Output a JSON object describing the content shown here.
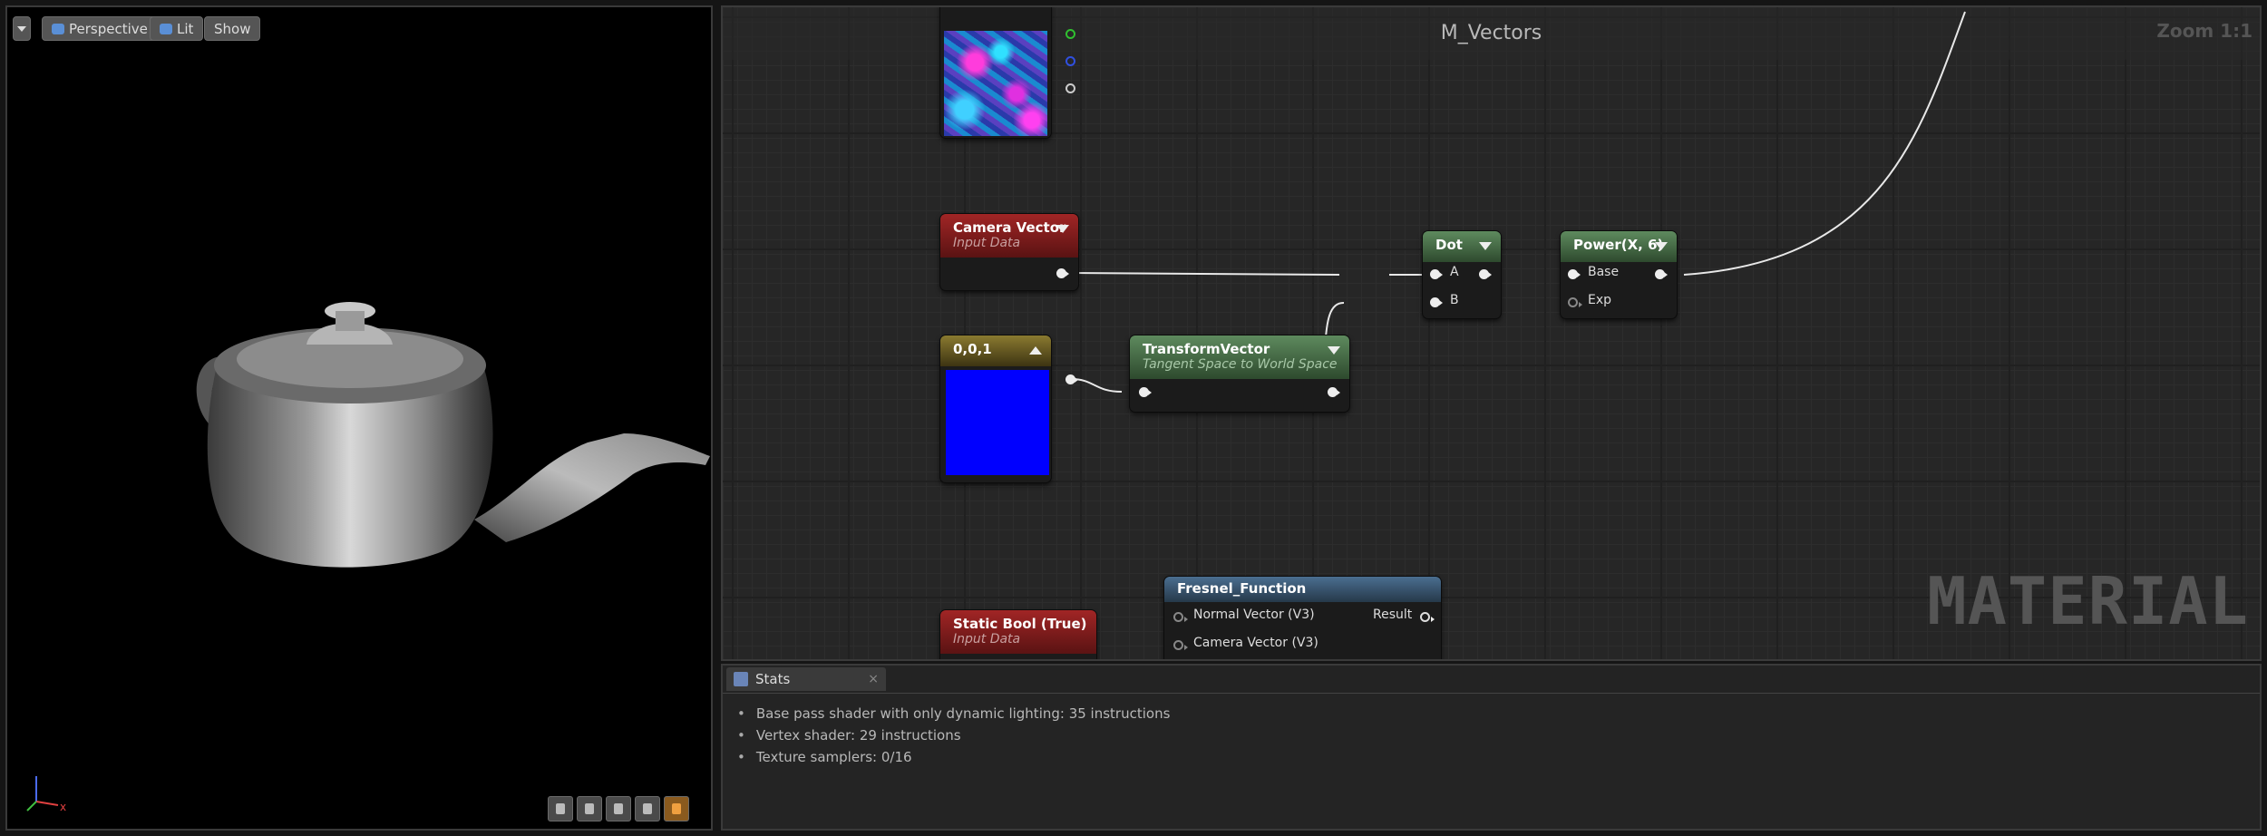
{
  "viewport": {
    "perspective_label": "Perspective",
    "lit_label": "Lit",
    "show_label": "Show",
    "axis_x": "x"
  },
  "graph": {
    "title": "M_Vectors",
    "zoom": "Zoom 1:1",
    "watermark": "MATERIAL",
    "nodes": {
      "camera_vector": {
        "title": "Camera Vector",
        "subtitle": "Input Data"
      },
      "constant": {
        "title": "0,0,1",
        "swatch_color": "#0000ff"
      },
      "transform_vector": {
        "title": "TransformVector",
        "subtitle": "Tangent Space to World Space"
      },
      "dot": {
        "title": "Dot",
        "pin_a": "A",
        "pin_b": "B"
      },
      "power": {
        "title": "Power(X, 6)",
        "pin_base": "Base",
        "pin_exp": "Exp"
      },
      "static_bool": {
        "title": "Static Bool (True)",
        "subtitle": "Input Data"
      },
      "fresnel": {
        "title": "Fresnel_Function",
        "input_normal": "Normal Vector (V3)",
        "input_camera": "Camera Vector (V3)",
        "output_result": "Result"
      }
    }
  },
  "stats": {
    "tab_label": "Stats",
    "close_glyph": "×",
    "items": [
      "Base pass shader with only dynamic lighting: 35 instructions",
      "Vertex shader: 29 instructions",
      "Texture samplers: 0/16"
    ]
  },
  "colors": {
    "node_red": "#a12525",
    "node_green": "#5e8a5e",
    "node_yellow": "#8a7a30",
    "node_blue": "#4a6e90"
  }
}
